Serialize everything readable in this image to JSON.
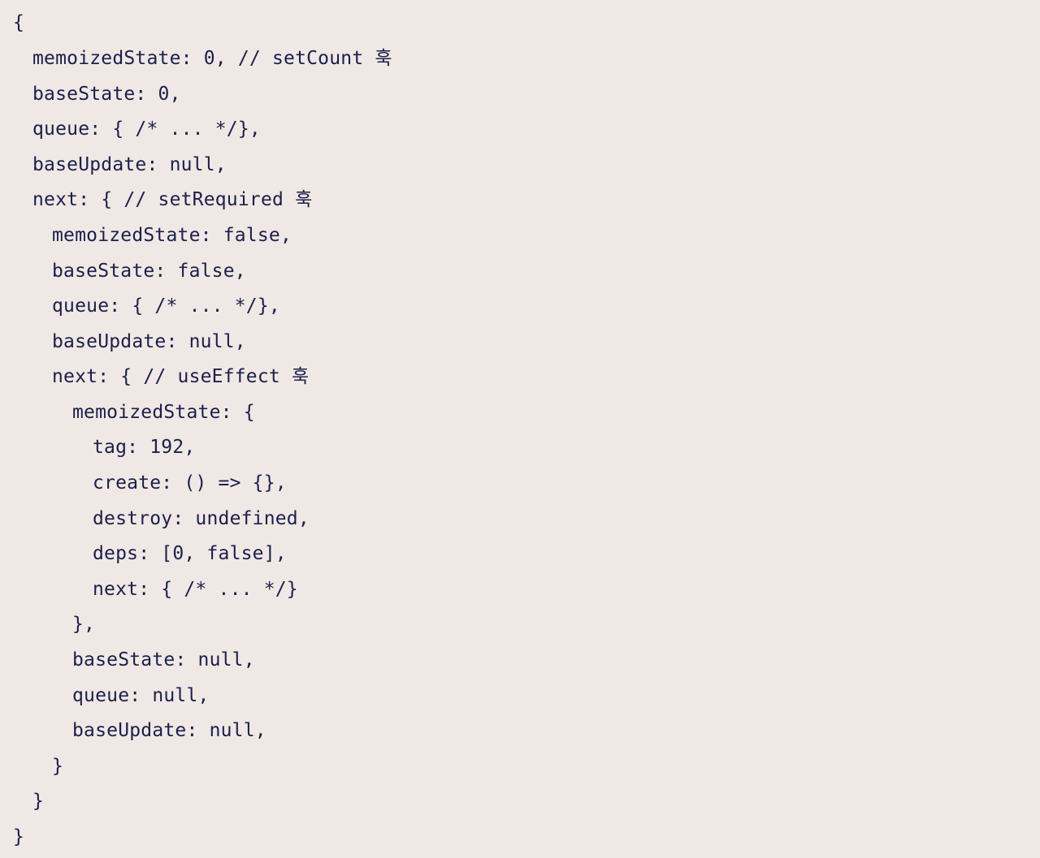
{
  "code": {
    "lines": [
      "{",
      "memoizedState: 0, // setCount 훅",
      "baseState: 0,",
      "queue: { /* ... */},",
      "baseUpdate: null,",
      "next: { // setRequired 훅",
      "memoizedState: false,",
      "baseState: false,",
      "queue: { /* ... */},",
      "baseUpdate: null,",
      "next: { // useEffect 훅",
      "memoizedState: {",
      "tag: 192,",
      "create: () => {},",
      "destroy: undefined,",
      "deps: [0, false],",
      "next: { /* ... */}",
      "},",
      "baseState: null,",
      "queue: null,",
      "baseUpdate: null,",
      "}",
      "}",
      "}"
    ]
  }
}
